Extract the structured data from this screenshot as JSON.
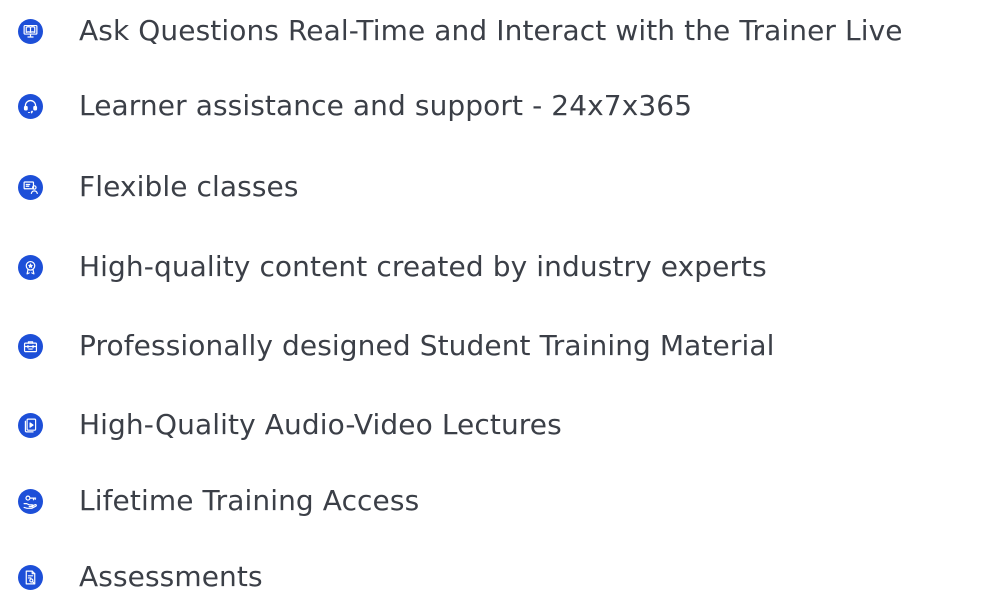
{
  "features": {
    "accent_color": "#1d4fd8",
    "items": [
      {
        "icon": "monitor-book-icon",
        "label": "Ask Questions Real-Time and Interact with the Trainer Live"
      },
      {
        "icon": "headset-247-icon",
        "label": "Learner assistance and support - 24x7x365"
      },
      {
        "icon": "online-class-icon",
        "label": "Flexible classes"
      },
      {
        "icon": "award-badge-icon",
        "label": "High-quality content created by industry experts"
      },
      {
        "icon": "toolbox-icon",
        "label": "Professionally designed Student Training Material"
      },
      {
        "icon": "video-lectures-icon",
        "label": "High-Quality Audio-Video Lectures"
      },
      {
        "icon": "key-hand-icon",
        "label": "Lifetime Training Access"
      },
      {
        "icon": "assessment-document-icon",
        "label": "Assessments"
      }
    ]
  }
}
